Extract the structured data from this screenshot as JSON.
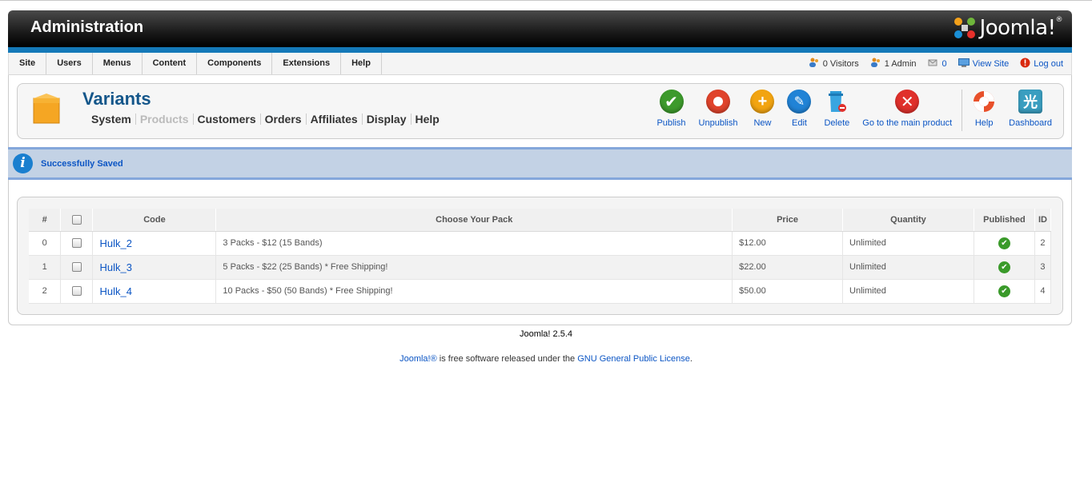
{
  "header": {
    "title": "Administration",
    "logo_text": "Joomla!",
    "logo_mark": "®"
  },
  "menu": [
    "Site",
    "Users",
    "Menus",
    "Content",
    "Components",
    "Extensions",
    "Help"
  ],
  "status": {
    "visitors": "0 Visitors",
    "admins": "1 Admin",
    "messages": "0",
    "view_site": "View Site",
    "logout": "Log out"
  },
  "page": {
    "title": "Variants",
    "submenu": [
      {
        "label": "System",
        "disabled": false
      },
      {
        "label": "Products",
        "disabled": true
      },
      {
        "label": "Customers",
        "disabled": false
      },
      {
        "label": "Orders",
        "disabled": false
      },
      {
        "label": "Affiliates",
        "disabled": false
      },
      {
        "label": "Display",
        "disabled": false
      },
      {
        "label": "Help",
        "disabled": false
      }
    ]
  },
  "toolbar": {
    "publish": "Publish",
    "unpublish": "Unpublish",
    "new": "New",
    "edit": "Edit",
    "delete": "Delete",
    "main_product": "Go to the main product",
    "help": "Help",
    "dashboard": "Dashboard"
  },
  "colors": {
    "publish": "#3d9a2c",
    "unpublish": "#e0432b",
    "new": "#f2a411",
    "edit": "#2183d6",
    "delete": "#2d9ad6",
    "main_product": "#e0302b",
    "accent": "#1479b8"
  },
  "message": "Successfully Saved",
  "table": {
    "headers": [
      "#",
      "",
      "Code",
      "Choose Your Pack",
      "Price",
      "Quantity",
      "Published",
      "ID"
    ],
    "rows": [
      {
        "num": "0",
        "code": "Hulk_2",
        "pack": "3 Packs - $12 (15 Bands)",
        "price": "$12.00",
        "quantity": "Unlimited",
        "id": "2"
      },
      {
        "num": "1",
        "code": "Hulk_3",
        "pack": "5 Packs - $22 (25 Bands) * Free Shipping!",
        "price": "$22.00",
        "quantity": "Unlimited",
        "id": "3"
      },
      {
        "num": "2",
        "code": "Hulk_4",
        "pack": "10 Packs - $50 (50 Bands) * Free Shipping!",
        "price": "$50.00",
        "quantity": "Unlimited",
        "id": "4"
      }
    ]
  },
  "footer": {
    "version": "Joomla! 2.5.4",
    "joomla_link": "Joomla!®",
    "text_mid": " is free software released under the ",
    "license_link": "GNU General Public License",
    "text_end": "."
  }
}
